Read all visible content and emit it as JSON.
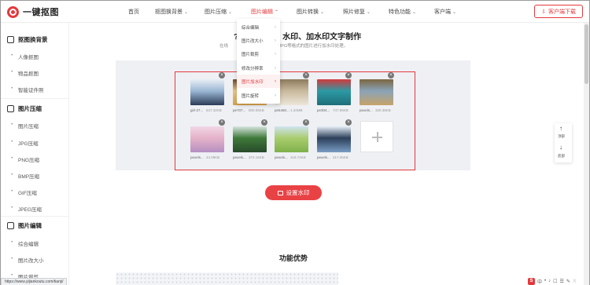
{
  "header": {
    "logo_text": "一键抠图",
    "nav": [
      {
        "label": "首页",
        "caret": false
      },
      {
        "label": "抠图换背景",
        "caret": true
      },
      {
        "label": "图片压缩",
        "caret": true
      },
      {
        "label": "图片编辑",
        "caret": true
      },
      {
        "label": "图片转换",
        "caret": true
      },
      {
        "label": "照片修复",
        "caret": true
      },
      {
        "label": "特色功能",
        "caret": true
      },
      {
        "label": "客户端",
        "caret": true
      }
    ],
    "active_nav": "图片编辑",
    "download_label": "客户端下载"
  },
  "sidebar": {
    "sections": [
      {
        "title": "抠图换背景",
        "items": [
          "人像抠图",
          "物品抠图",
          "智能证件照"
        ]
      },
      {
        "title": "图片压缩",
        "items": [
          "图片压缩",
          "JPG压缩",
          "PNG压缩",
          "BMP压缩",
          "GIF压缩",
          "JPEG压缩"
        ]
      },
      {
        "title": "图片编辑",
        "items": [
          "综合编辑",
          "图片改大小",
          "图片裁剪"
        ]
      }
    ]
  },
  "main": {
    "title": "添加水印、加水印文字制作",
    "subtitle": "在线为PNG、JPG等格式的图片进行加水印处理。",
    "title_prefix": "?",
    "title_visible": "水印、加水印文字制作",
    "subtitle_visible": "PNG、JPG等格式的图片进行加水印处理。",
    "subtitle_prefix": "在线",
    "watermark_button": "设置水印",
    "advantages_title": "功能优势"
  },
  "images": [
    {
      "name": "girl-27...",
      "size": "647.32KB",
      "colors": [
        "#2b3b55",
        "#9bb7d4",
        "#e9eef4"
      ]
    },
    {
      "name": "pe707...",
      "size": "800.06KB",
      "colors": [
        "#d8a24a",
        "#e9c88b",
        "#6b4a2a"
      ]
    },
    {
      "name": "pe5450...",
      "size": "1.34MB",
      "colors": [
        "#ece6da",
        "#c9b99d",
        "#8c7a5c"
      ]
    },
    {
      "name": "pe304...",
      "size": "747.99KB",
      "colors": [
        "#1d6e79",
        "#2d9aa4",
        "#d23a3d"
      ]
    },
    {
      "name": "pexels...",
      "size": "330.38KB",
      "colors": [
        "#c6a36a",
        "#8aa3b8",
        "#7a6640"
      ]
    },
    {
      "name": "pexels...",
      "size": "44.09KB",
      "colors": [
        "#b58fc2",
        "#e5b2c8",
        "#f0d6e6"
      ]
    },
    {
      "name": "pexels...",
      "size": "374.16KB",
      "colors": [
        "#284a2a",
        "#3f7a3a",
        "#d6e4e0"
      ]
    },
    {
      "name": "pexels...",
      "size": "418.74KB",
      "colors": [
        "#7fb04a",
        "#a9cd6e",
        "#cfe3f0"
      ]
    },
    {
      "name": "pexels...",
      "size": "217.06KB",
      "colors": [
        "#7a9cc4",
        "#2b3f5a",
        "#e6eef6"
      ]
    }
  ],
  "dropdown": {
    "items": [
      "综合编辑",
      "图片改大小",
      "图片裁剪",
      "修改分辨率",
      "图片加水印",
      "图片旋转"
    ],
    "active": "图片加水印"
  },
  "float_panel": {
    "top_label": "顶部",
    "bottom_label": "底部",
    "top_glyph": "↑",
    "bottom_glyph": "↓"
  },
  "status_url": "https://www.yijiankoutu.com/tianji/",
  "tray": {
    "s_label": "S",
    "icons": [
      "中",
      "•",
      "♪",
      "☐",
      "☰",
      "✎",
      "⁙"
    ]
  },
  "colors": {
    "accent": "#e4393c",
    "panel": "#eef0f4"
  }
}
